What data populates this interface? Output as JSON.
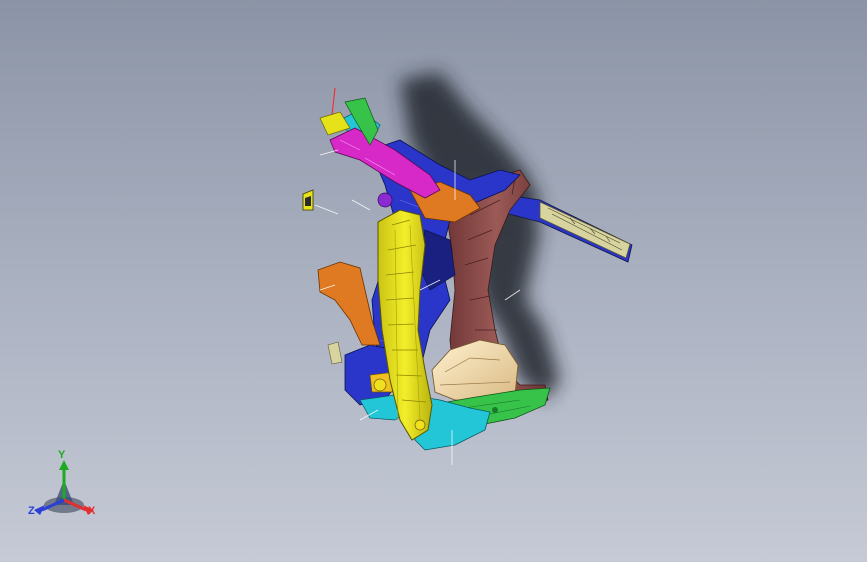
{
  "viewport": {
    "background_top": "#8b94a6",
    "background_bottom": "#c6cad6"
  },
  "model": {
    "description_icon": "car-body-a-pillar-assembly",
    "part_colors": {
      "pillar": "#e6e21a",
      "pillar_inner": "#c2bd0f",
      "brown_panel": "#8a4a4a",
      "magenta_rail": "#d629c8",
      "blue_parts": "#2a35c9",
      "cyan_parts": "#22c6d6",
      "orange_parts": "#e07a22",
      "green_floor": "#37c24a",
      "cream_housing": "#f2ddb0",
      "beige_beam": "#d8d4a0",
      "shadow": "#2a2d35"
    }
  },
  "triad": {
    "x_label": "X",
    "y_label": "Y",
    "z_label": "Z",
    "x_color": "#e23030",
    "y_color": "#1faa1f",
    "z_color": "#2a3fd6"
  }
}
